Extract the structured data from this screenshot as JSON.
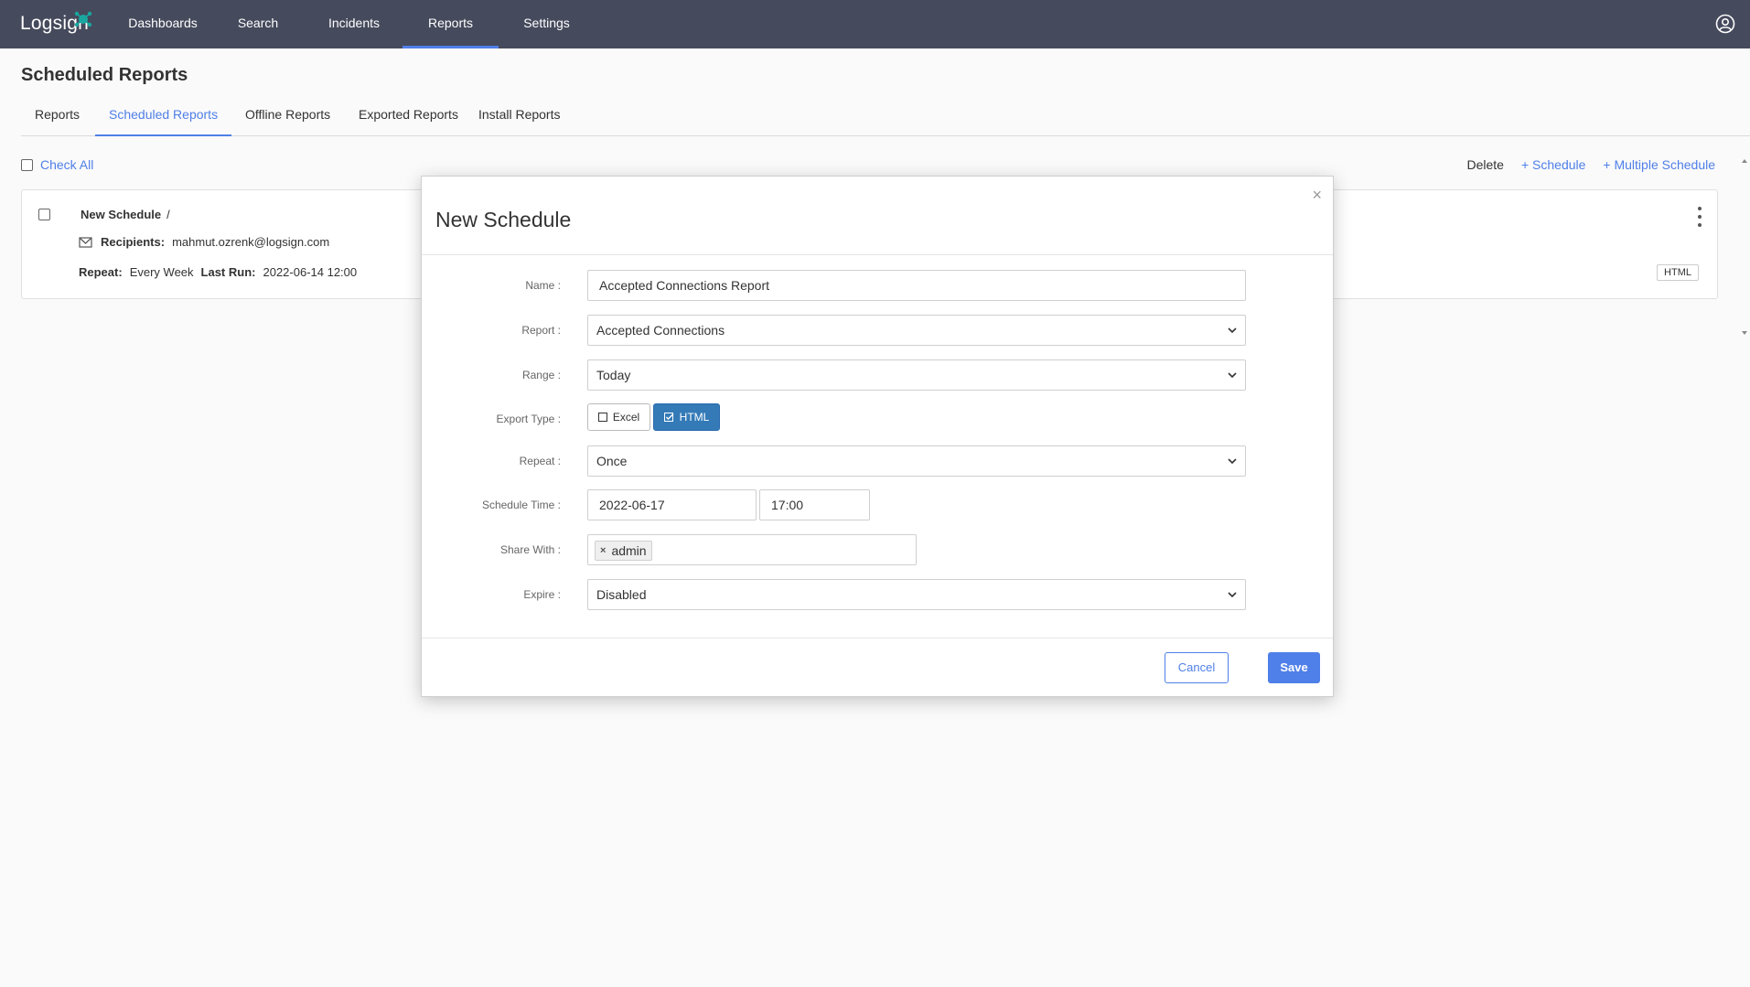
{
  "app": {
    "logo_text": "Logsign"
  },
  "nav": {
    "items": [
      {
        "label": "Dashboards"
      },
      {
        "label": "Search"
      },
      {
        "label": "Incidents"
      },
      {
        "label": "Reports"
      },
      {
        "label": "Settings"
      }
    ],
    "active": "Reports"
  },
  "page": {
    "title": "Scheduled Reports"
  },
  "tabs": {
    "items": [
      {
        "label": "Reports"
      },
      {
        "label": "Scheduled Reports"
      },
      {
        "label": "Offline Reports"
      },
      {
        "label": "Exported Reports"
      },
      {
        "label": "Install Reports"
      }
    ],
    "active": "Scheduled Reports"
  },
  "toolbar": {
    "check_all": "Check All",
    "delete": "Delete",
    "schedule": "+ Schedule",
    "multiple_schedule": "+ Multiple Schedule"
  },
  "schedule_card": {
    "title": "New Schedule",
    "separator": "/",
    "recipients_label": "Recipients:",
    "recipients_value": "mahmut.ozrenk@logsign.com",
    "repeat_label": "Repeat:",
    "repeat_value": "Every Week",
    "last_run_label": "Last Run:",
    "last_run_value": "2022-06-14 12:00",
    "export_tag": "HTML"
  },
  "modal": {
    "title": "New Schedule",
    "close": "×",
    "fields": {
      "name": {
        "label": "Name :",
        "value": "Accepted Connections Report"
      },
      "report": {
        "label": "Report :",
        "value": "Accepted Connections"
      },
      "range": {
        "label": "Range :",
        "value": "Today"
      },
      "export_type": {
        "label": "Export Type :",
        "excel": "Excel",
        "html": "HTML",
        "selected": "HTML"
      },
      "repeat": {
        "label": "Repeat :",
        "value": "Once"
      },
      "schedule_time": {
        "label": "Schedule Time :",
        "date": "2022-06-17",
        "time": "17:00"
      },
      "share_with": {
        "label": "Share With :",
        "chips": [
          "admin"
        ],
        "chip_remove": "×"
      },
      "expire": {
        "label": "Expire :",
        "value": "Disabled"
      }
    },
    "buttons": {
      "cancel": "Cancel",
      "save": "Save"
    }
  },
  "colors": {
    "navbar": "#454a5c",
    "accent": "#4f7fe8",
    "html_button": "#337ab7",
    "logo_mark": "#19a7a0"
  }
}
